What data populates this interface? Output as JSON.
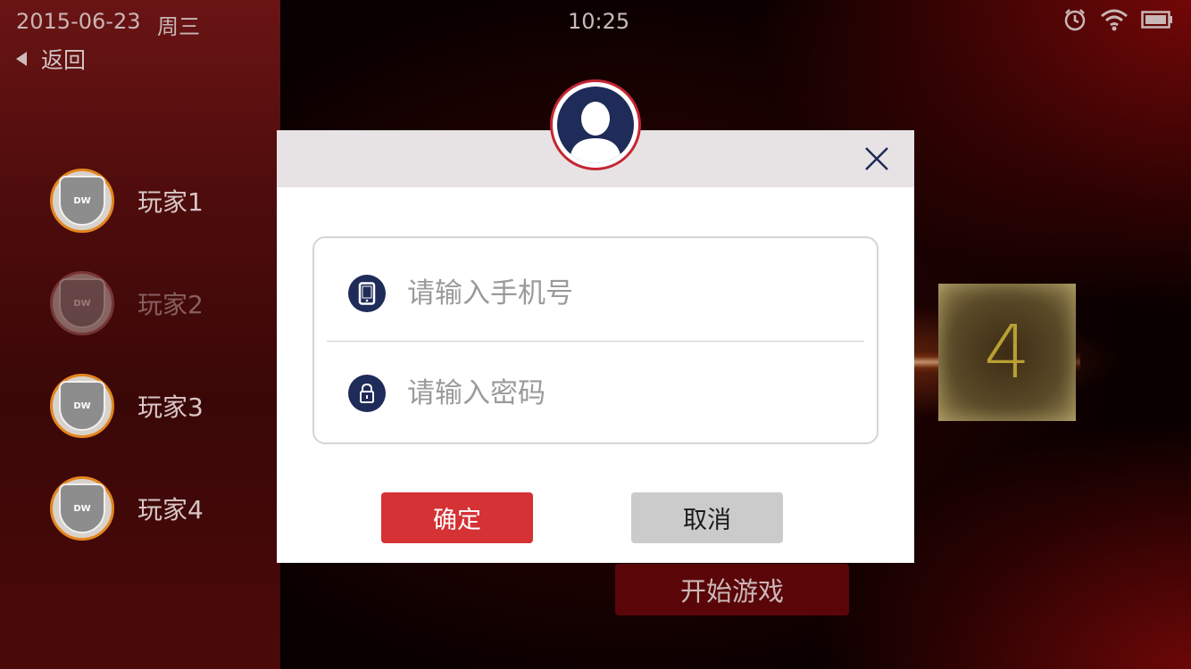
{
  "status_bar": {
    "date": "2015-06-23",
    "weekday": "周三",
    "time": "10:25",
    "icons": [
      "alarm-icon",
      "wifi-icon",
      "battery-icon"
    ]
  },
  "sidebar": {
    "back_label": "返回",
    "players": [
      {
        "label": "玩家1",
        "active": true
      },
      {
        "label": "玩家2",
        "active": false
      },
      {
        "label": "玩家3",
        "active": true
      },
      {
        "label": "玩家4",
        "active": true
      }
    ]
  },
  "main": {
    "number": "4",
    "start_label": "开始游戏"
  },
  "dialog": {
    "phone_placeholder": "请输入手机号",
    "password_placeholder": "请输入密码",
    "confirm_label": "确定",
    "cancel_label": "取消"
  },
  "colors": {
    "accent": "#d43235",
    "navy": "#1f2b58",
    "avatar_ring": "#c52532"
  }
}
